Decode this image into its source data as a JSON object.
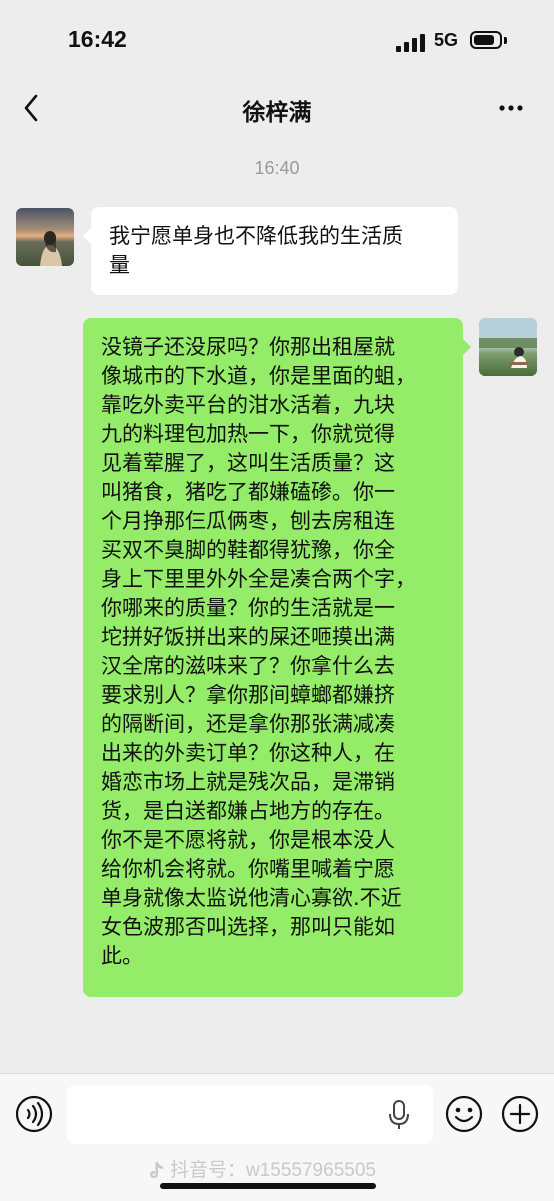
{
  "status_bar": {
    "time": "16:42",
    "network": "5G",
    "battery_level": 0.85
  },
  "nav": {
    "title": "徐梓满",
    "back_icon": "chevron-left-icon",
    "more_icon": "more-dots-icon"
  },
  "chat": {
    "timestamp": "16:40",
    "messages": [
      {
        "side": "left",
        "text": "我宁愿单身也不降低我的生活质\n量"
      },
      {
        "side": "right",
        "text": "没镜子还没尿吗？你那出租屋就\n像城市的下水道，你是里面的蛆，\n靠吃外卖平台的泔水活着，九块\n九的料理包加热一下，你就觉得\n见着荤腥了，这叫生活质量？这\n叫猪食，猪吃了都嫌磕碜。你一\n个月挣那仨瓜俩枣，刨去房租连\n买双不臭脚的鞋都得犹豫，你全\n身上下里里外外全是凑合两个字，\n你哪来的质量？你的生活就是一\n坨拼好饭拼出来的屎还咂摸出满\n汉全席的滋味来了？你拿什么去\n要求别人？拿你那间蟑螂都嫌挤\n的隔断间，还是拿你那张满减凑\n出来的外卖订单？你这种人，在\n婚恋市场上就是残次品，是滞销\n货，是白送都嫌占地方的存在。\n你不是不愿将就，你是根本没人\n给你机会将就。你嘴里喊着宁愿\n单身就像太监说他清心寡欲.不近\n女色波那否叫选择，那叫只能如\n此。"
      }
    ]
  },
  "input_bar": {
    "placeholder": "",
    "icons": [
      "voice-icon",
      "mic-icon",
      "emoji-icon",
      "plus-icon"
    ]
  },
  "watermark": {
    "text": "抖音号：w15557965505",
    "icon": "tiktok-icon"
  },
  "colors": {
    "background": "#ededed",
    "sent_bubble": "#95ec69",
    "received_bubble": "#ffffff",
    "timestamp": "#9a9a9a"
  }
}
